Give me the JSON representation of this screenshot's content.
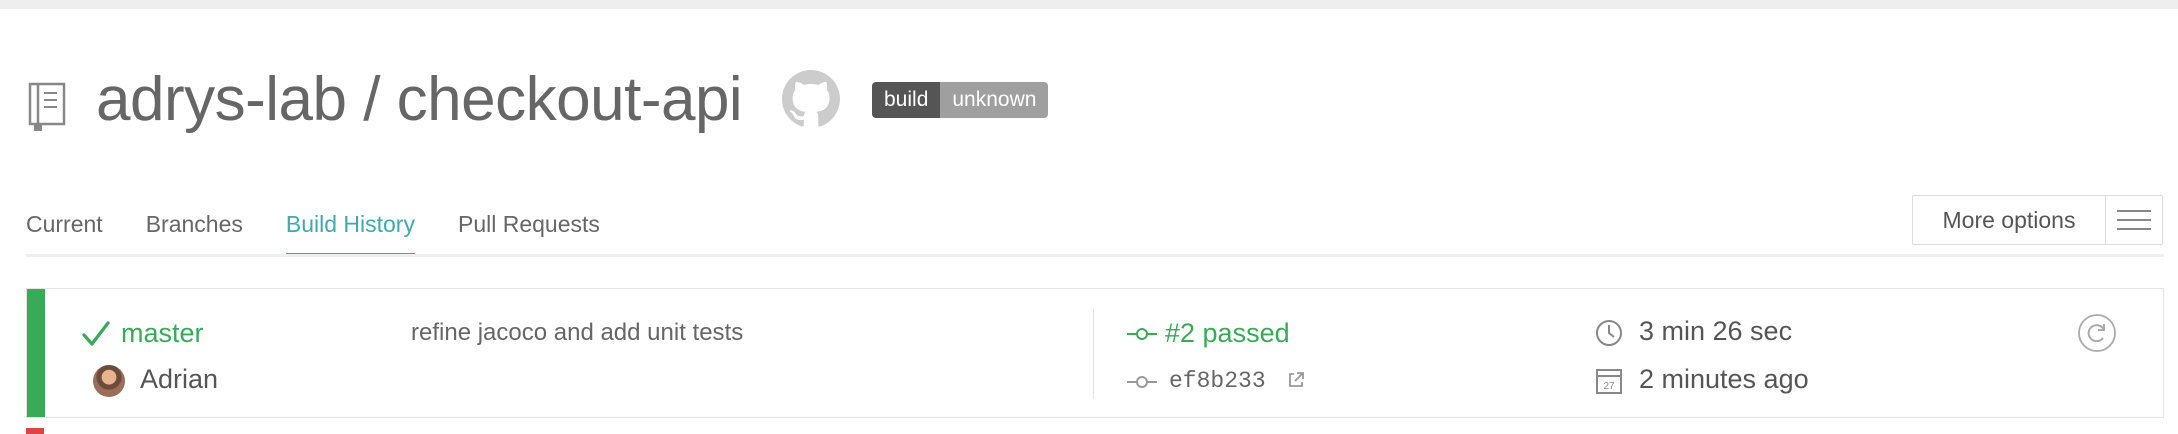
{
  "repo": {
    "title": "adrys-lab / checkout-api",
    "icon": "repo-book-icon",
    "provider_icon": "github-icon",
    "badge": {
      "left": "build",
      "right": "unknown",
      "left_color": "#555555",
      "right_color": "#9f9f9f"
    }
  },
  "tabs": [
    {
      "label": "Current",
      "active": false
    },
    {
      "label": "Branches",
      "active": false
    },
    {
      "label": "Build History",
      "active": true
    },
    {
      "label": "Pull Requests",
      "active": false
    }
  ],
  "more_options": {
    "label": "More options",
    "icon": "hamburger-menu-icon"
  },
  "builds": [
    {
      "state": "passed",
      "state_color": "#39aa56",
      "branch": "master",
      "author": "Adrian",
      "message": "refine jacoco and add unit tests",
      "build_label": "#2 passed",
      "commit": "ef8b233",
      "duration": "3 min 26 sec",
      "finished": "2 minutes ago",
      "calendar_day": "27"
    }
  ],
  "colors": {
    "accent": "#3eaaaf",
    "passed": "#39aa56",
    "failed": "#db4545",
    "text": "#666666"
  }
}
